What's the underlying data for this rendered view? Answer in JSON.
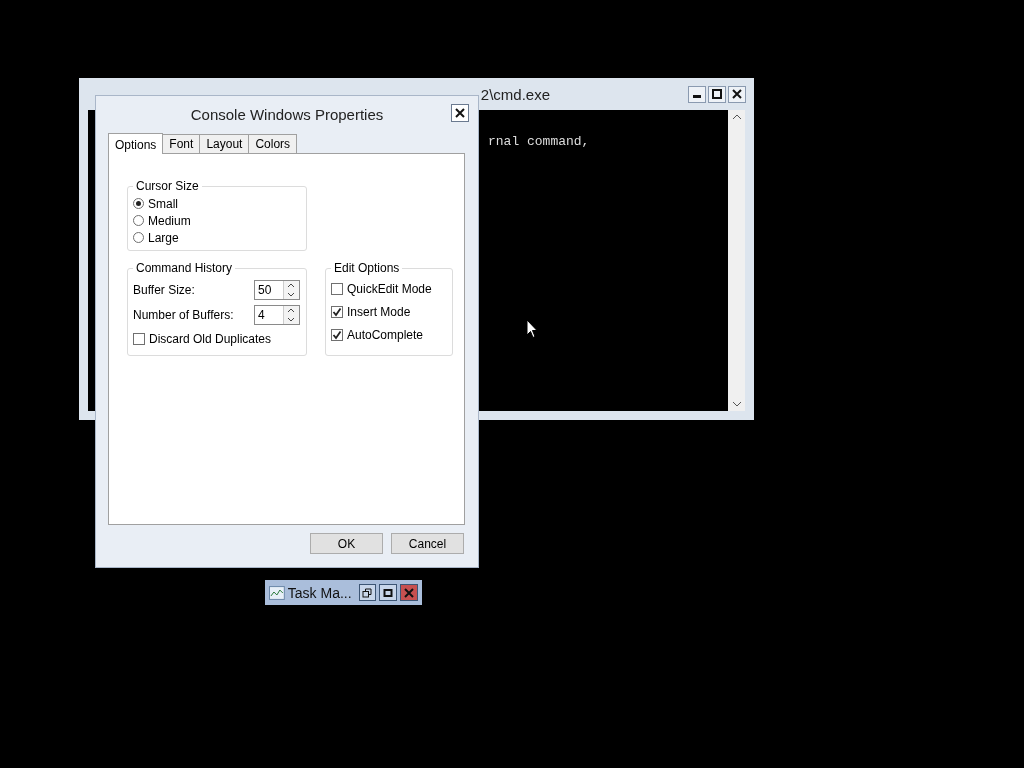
{
  "background_window": {
    "title": "2\\cmd.exe",
    "console_text": "rnal command,"
  },
  "dialog": {
    "title": "Console Windows Properties",
    "tabs": [
      {
        "label": "Options",
        "selected": true
      },
      {
        "label": "Font",
        "selected": false
      },
      {
        "label": "Layout",
        "selected": false
      },
      {
        "label": "Colors",
        "selected": false
      }
    ],
    "cursor_size": {
      "label": "Cursor Size",
      "options": [
        {
          "label": "Small",
          "selected": true
        },
        {
          "label": "Medium",
          "selected": false
        },
        {
          "label": "Large",
          "selected": false
        }
      ]
    },
    "command_history": {
      "label": "Command History",
      "buffer_size": {
        "label": "Buffer Size:",
        "value": "50"
      },
      "number_of_buffers": {
        "label": "Number of Buffers:",
        "value": "4"
      },
      "discard_old_duplicates": {
        "label": "Discard Old Duplicates",
        "checked": false
      }
    },
    "edit_options": {
      "label": "Edit Options",
      "options": [
        {
          "label": "QuickEdit Mode",
          "checked": false
        },
        {
          "label": "Insert Mode",
          "checked": true
        },
        {
          "label": "AutoComplete",
          "checked": true
        }
      ]
    },
    "buttons": [
      "OK",
      "Cancel"
    ]
  },
  "minimized_window": {
    "title": "Task Ma..."
  }
}
